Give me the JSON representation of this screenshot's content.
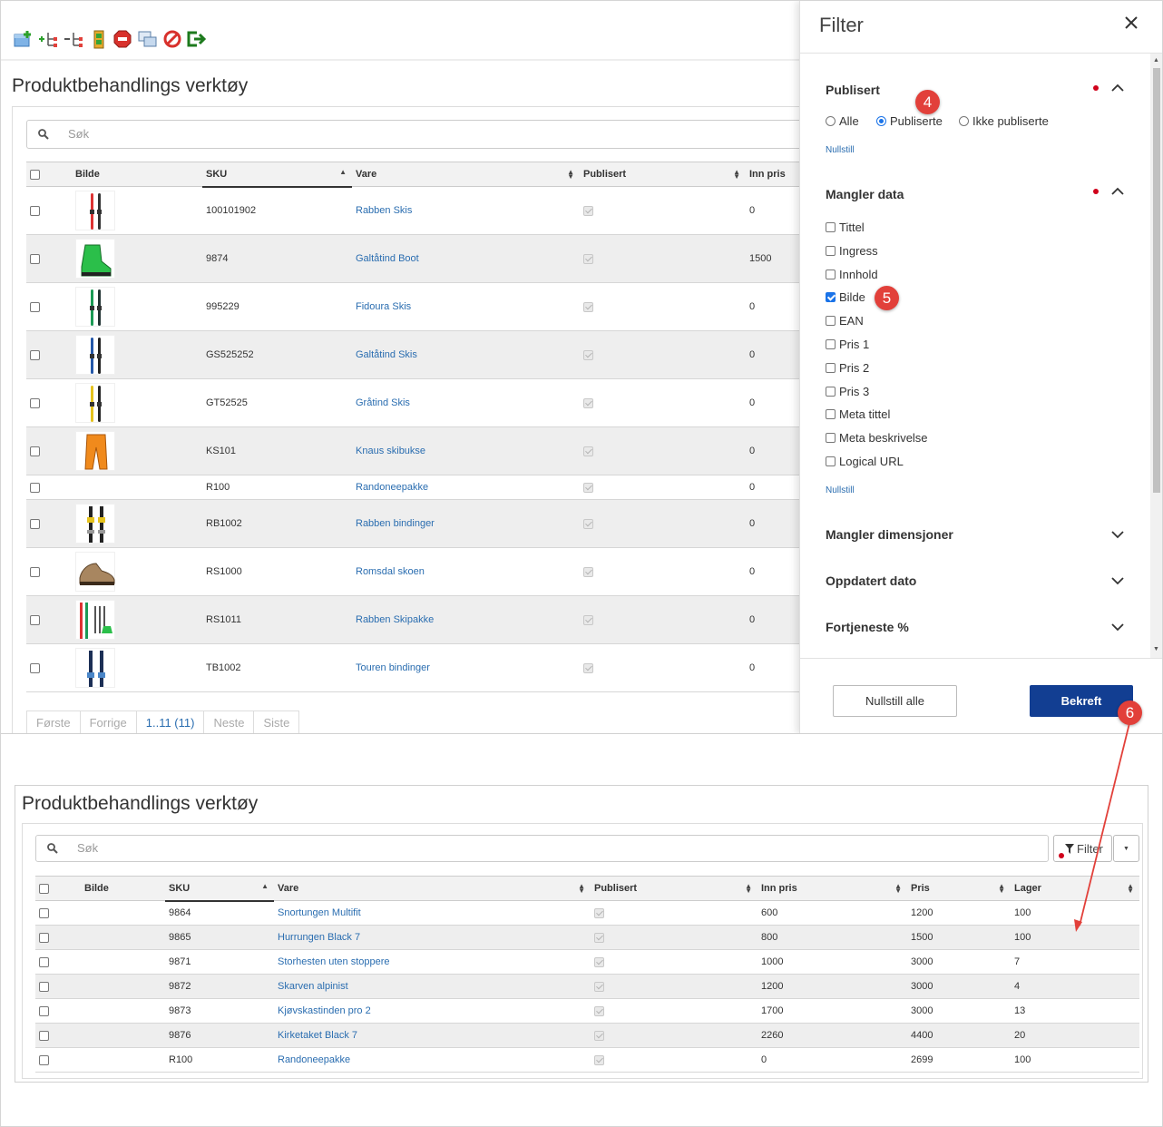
{
  "top": {
    "title": "Produktbehandlings verktøy",
    "search_placeholder": "Søk",
    "columns": {
      "image": "Bilde",
      "sku": "SKU",
      "item": "Vare",
      "published": "Publisert",
      "cost": "Inn pris"
    },
    "rows": [
      {
        "sku": "100101902",
        "name": "Rabben Skis",
        "cost": "0",
        "thumb": "skis-red"
      },
      {
        "sku": "9874",
        "name": "Galtåtind Boot",
        "cost": "1500",
        "thumb": "boot-green"
      },
      {
        "sku": "995229",
        "name": "Fidoura Skis",
        "cost": "0",
        "thumb": "skis-green"
      },
      {
        "sku": "GS525252",
        "name": "Galtåtind Skis",
        "cost": "0",
        "thumb": "skis-blue"
      },
      {
        "sku": "GT52525",
        "name": "Gråtind Skis",
        "cost": "0",
        "thumb": "skis-yellow"
      },
      {
        "sku": "KS101",
        "name": "Knaus skibukse",
        "cost": "0",
        "thumb": "pants-orange"
      },
      {
        "sku": "R100",
        "name": "Randoneepakke",
        "cost": "0",
        "thumb": ""
      },
      {
        "sku": "RB1002",
        "name": "Rabben bindinger",
        "cost": "0",
        "thumb": "bindings"
      },
      {
        "sku": "RS1000",
        "name": "Romsdal skoen",
        "cost": "0",
        "thumb": "shoe-brown"
      },
      {
        "sku": "RS1011",
        "name": "Rabben Skipakke",
        "cost": "0",
        "thumb": "skipack"
      },
      {
        "sku": "TB1002",
        "name": "Touren bindinger",
        "cost": "0",
        "thumb": "bindings-blue"
      }
    ],
    "pager": [
      "Første",
      "Forrige",
      "1..11 (11)",
      "Neste",
      "Siste"
    ]
  },
  "filter": {
    "title": "Filter",
    "published": {
      "title": "Publisert",
      "options": [
        "Alle",
        "Publiserte",
        "Ikke publiserte"
      ],
      "selected": "Publiserte",
      "reset": "Nullstill"
    },
    "missing": {
      "title": "Mangler data",
      "options": [
        "Tittel",
        "Ingress",
        "Innhold",
        "Bilde",
        "EAN",
        "Pris 1",
        "Pris 2",
        "Pris 3",
        "Meta tittel",
        "Meta beskrivelse",
        "Logical URL"
      ],
      "checked": "Bilde",
      "reset": "Nullstill"
    },
    "collapsed": [
      "Mangler dimensjoner",
      "Oppdatert dato",
      "Fortjeneste %"
    ],
    "reset_all": "Nullstill alle",
    "confirm": "Bekreft"
  },
  "badges": [
    "4",
    "5",
    "6"
  ],
  "bottom": {
    "title": "Produktbehandlings verktøy",
    "search_placeholder": "Søk",
    "filter_label": "Filter",
    "columns": {
      "image": "Bilde",
      "sku": "SKU",
      "item": "Vare",
      "published": "Publisert",
      "cost": "Inn pris",
      "price": "Pris",
      "stock": "Lager"
    },
    "rows": [
      {
        "sku": "9864",
        "name": "Snortungen Multifit",
        "cost": "600",
        "price": "1200",
        "stock": "100"
      },
      {
        "sku": "9865",
        "name": "Hurrungen Black 7",
        "cost": "800",
        "price": "1500",
        "stock": "100"
      },
      {
        "sku": "9871",
        "name": "Storhesten uten stoppere",
        "cost": "1000",
        "price": "3000",
        "stock": "7"
      },
      {
        "sku": "9872",
        "name": "Skarven alpinist",
        "cost": "1200",
        "price": "3000",
        "stock": "4"
      },
      {
        "sku": "9873",
        "name": "Kjøvskastinden pro 2",
        "cost": "1700",
        "price": "3000",
        "stock": "13"
      },
      {
        "sku": "9876",
        "name": "Kirketaket Black 7",
        "cost": "2260",
        "price": "4400",
        "stock": "20"
      },
      {
        "sku": "R100",
        "name": "Randoneepakke",
        "cost": "0",
        "price": "2699",
        "stock": "100"
      }
    ]
  },
  "colors": {
    "link": "#2a6db0",
    "confirm": "#123e92",
    "badge": "#e2403a",
    "dot": "#d0021b",
    "arrow": "#e2403a"
  }
}
